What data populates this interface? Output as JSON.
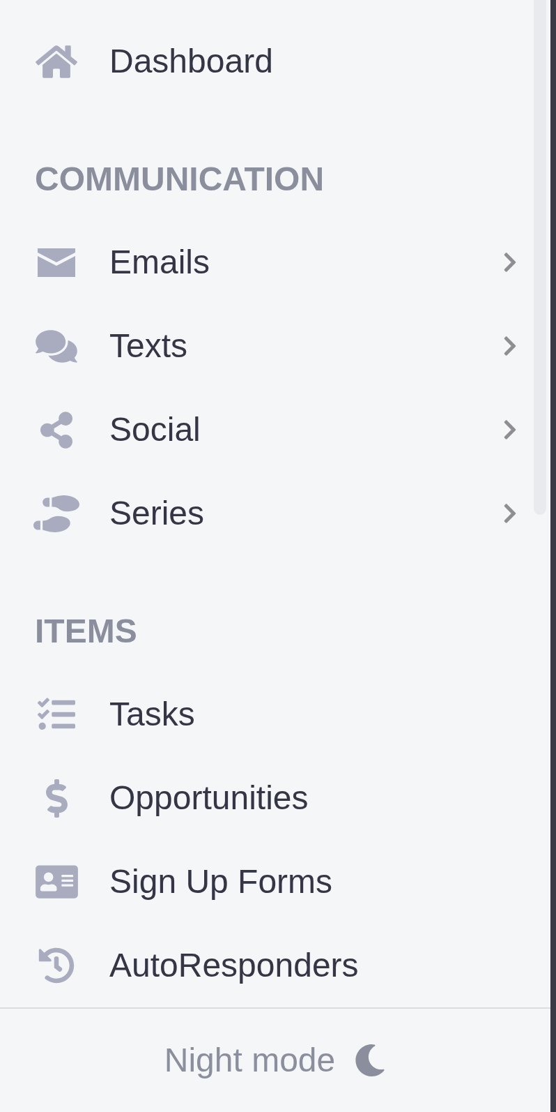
{
  "sidebar": {
    "top_items": [
      {
        "label": "Dashboard",
        "submenu": false
      }
    ],
    "sections": [
      {
        "title": "COMMUNICATION",
        "items": [
          {
            "label": "Emails",
            "submenu": true
          },
          {
            "label": "Texts",
            "submenu": true
          },
          {
            "label": "Social",
            "submenu": true
          },
          {
            "label": "Series",
            "submenu": true
          }
        ]
      },
      {
        "title": "ITEMS",
        "items": [
          {
            "label": "Tasks",
            "submenu": false
          },
          {
            "label": "Opportunities",
            "submenu": false
          },
          {
            "label": "Sign Up Forms",
            "submenu": false
          },
          {
            "label": "AutoResponders",
            "submenu": false
          }
        ]
      }
    ]
  },
  "footer": {
    "night_mode": {
      "label": "Night mode"
    }
  }
}
